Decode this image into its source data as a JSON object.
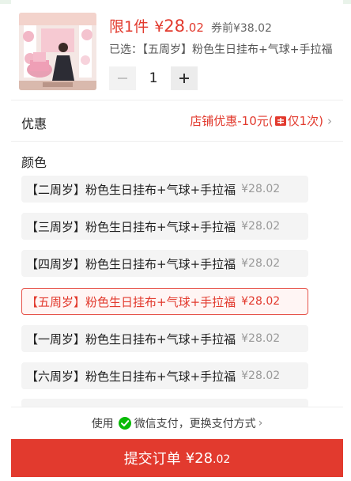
{
  "product": {
    "limit_label": "限1件",
    "currency": "¥",
    "price_int": "28",
    "price_dec": ".02",
    "original_price": "券前¥38.02",
    "selected_text": "已选：【五周岁】粉色生日挂布+气球+手拉福"
  },
  "quantity": {
    "value": "1",
    "minus_label": "−",
    "plus_label": "+"
  },
  "discount": {
    "label": "优惠",
    "value_prefix": "店铺优惠-10元(",
    "value_suffix": "仅1次)",
    "chevron": "›"
  },
  "color": {
    "title": "颜色",
    "options": [
      {
        "label": "【二周岁】粉色生日挂布+气球+手拉福",
        "price": "¥28.02",
        "selected": false
      },
      {
        "label": "【三周岁】粉色生日挂布+气球+手拉福",
        "price": "¥28.02",
        "selected": false
      },
      {
        "label": "【四周岁】粉色生日挂布+气球+手拉福",
        "price": "¥28.02",
        "selected": false
      },
      {
        "label": "【五周岁】粉色生日挂布+气球+手拉福",
        "price": "¥28.02",
        "selected": true
      },
      {
        "label": "【一周岁】粉色生日挂布+气球+手拉福",
        "price": "¥28.02",
        "selected": false
      },
      {
        "label": "【六周岁】粉色生日挂布+气球+手拉福",
        "price": "¥28.02",
        "selected": false
      }
    ]
  },
  "payment": {
    "prefix": "使用",
    "method": "微信支付",
    "suffix": "，更换支付方式",
    "chevron": "›",
    "icon": "wechat-pay-icon"
  },
  "submit": {
    "label": "提交订单",
    "amount_int": "¥28",
    "amount_dec": ".02"
  },
  "colors": {
    "accent": "#e23a2e",
    "wechat_green": "#09bb07",
    "option_bg": "#f4f4f4"
  }
}
